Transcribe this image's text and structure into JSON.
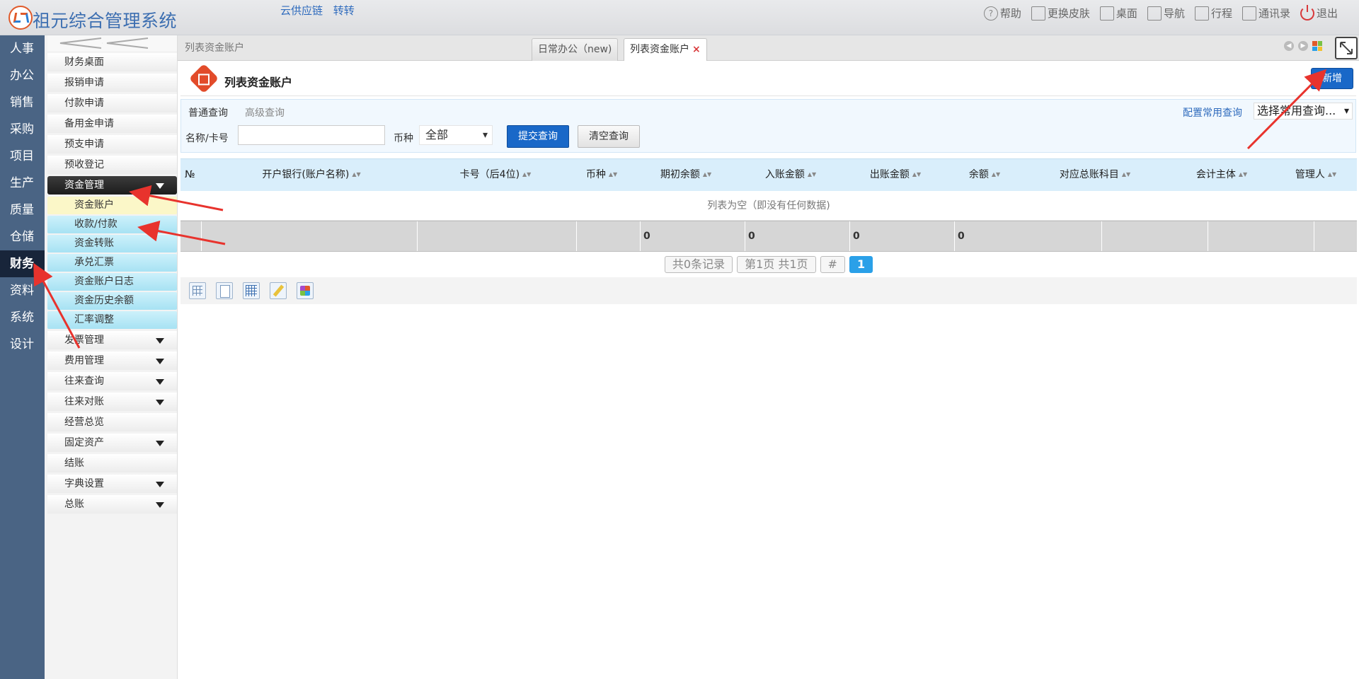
{
  "app": {
    "title": "祖元综合管理系统"
  },
  "top_links": [
    "云供应链",
    "转转"
  ],
  "top_actions": [
    {
      "label": "帮助",
      "icon": "help-icon"
    },
    {
      "label": "更换皮肤",
      "icon": "shirt-icon"
    },
    {
      "label": "桌面",
      "icon": "home-icon"
    },
    {
      "label": "导航",
      "icon": "nav-grid-icon"
    },
    {
      "label": "行程",
      "icon": "calendar-icon"
    },
    {
      "label": "通讯录",
      "icon": "contacts-icon"
    },
    {
      "label": "退出",
      "icon": "power-icon"
    }
  ],
  "rail": {
    "items": [
      "人事",
      "办公",
      "销售",
      "采购",
      "项目",
      "生产",
      "质量",
      "仓储",
      "财务",
      "资料",
      "系统",
      "设计"
    ],
    "active": "财务"
  },
  "submenu": {
    "items_top": [
      "财务桌面",
      "报销申请",
      "付款申请",
      "备用金申请",
      "预支申请",
      "预收登记"
    ],
    "open_group": "资金管理",
    "open_group_children": [
      "资金账户",
      "收款/付款",
      "资金转账",
      "承兑汇票",
      "资金账户日志",
      "资金历史余额",
      "汇率调整"
    ],
    "selected_child": "资金账户",
    "groups_after": [
      {
        "label": "发票管理",
        "expandable": true
      },
      {
        "label": "费用管理",
        "expandable": true
      },
      {
        "label": "往来查询",
        "expandable": true
      },
      {
        "label": "往来对账",
        "expandable": true
      },
      {
        "label": "经营总览",
        "expandable": false
      },
      {
        "label": "固定资产",
        "expandable": true
      },
      {
        "label": "结账",
        "expandable": false
      },
      {
        "label": "字典设置",
        "expandable": true
      },
      {
        "label": "总账",
        "expandable": true
      }
    ]
  },
  "tabs": {
    "breadcrumb": "列表资金账户",
    "items": [
      {
        "label": "日常办公（new)",
        "active": false,
        "closable": false
      },
      {
        "label": "列表资金账户",
        "active": true,
        "closable": true,
        "close_symbol": "×"
      }
    ]
  },
  "page": {
    "title": "列表资金账户",
    "add_button": "新增"
  },
  "query": {
    "tab_normal": "普通查询",
    "tab_advanced": "高级查询",
    "config_link": "配置常用查询",
    "saved_query_select": "选择常用查询...",
    "name_label": "名称/卡号",
    "name_value": "",
    "currency_label": "币种",
    "currency_value": "全部",
    "submit_label": "提交查询",
    "clear_label": "清空查询"
  },
  "grid": {
    "columns": [
      "№",
      "开户银行(账户名称)",
      "卡号（后4位)",
      "币种",
      "期初余额",
      "入账金额",
      "出账金额",
      "余额",
      "对应总账科目",
      "会计主体",
      "管理人"
    ],
    "empty_text": "列表为空（即没有任何数据)",
    "summary": [
      "",
      "",
      "",
      "",
      "0",
      "0",
      "0",
      "0",
      "",
      "",
      ""
    ]
  },
  "pager": {
    "total": "共0条记录",
    "page_info": "第1页 共1页",
    "hash": "#",
    "current": "1"
  },
  "tools": [
    "grid-view-icon",
    "document-icon",
    "table-icon",
    "edit-icon",
    "flow-icon"
  ],
  "colors": {
    "rail_bg": "#4a6484",
    "rail_active": "#18253a",
    "primary_button": "#1968c8",
    "grid_header": "#d9eefb",
    "annotation_arrow": "#e8332d"
  }
}
